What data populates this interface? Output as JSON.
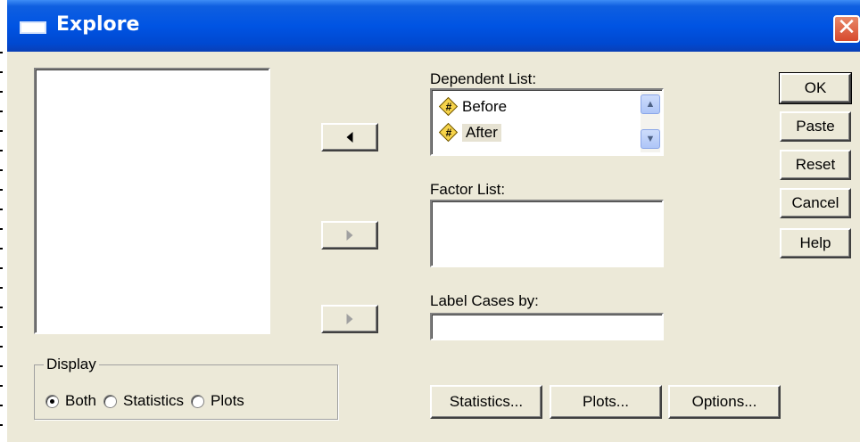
{
  "window": {
    "title": "Explore",
    "close_glyph": "✕"
  },
  "dependent_list": {
    "label": "Dependent List:",
    "items": [
      {
        "icon": "numeric-variable-icon",
        "label": "Before"
      },
      {
        "icon": "numeric-variable-icon",
        "label": "After"
      }
    ],
    "scroll_up": "▲",
    "scroll_down": "▼"
  },
  "factor_list": {
    "label": "Factor List:"
  },
  "label_cases": {
    "label": "Label Cases by:",
    "value": ""
  },
  "variable_icon_glyph": "#",
  "buttons": {
    "ok": "OK",
    "paste": "Paste",
    "reset": "Reset",
    "cancel": "Cancel",
    "help": "Help",
    "statistics": "Statistics...",
    "plots": "Plots...",
    "options": "Options..."
  },
  "display": {
    "title": "Display",
    "options": [
      "Both",
      "Statistics",
      "Plots"
    ],
    "selected": "Both"
  },
  "colors": {
    "titlebar": "#0054e3",
    "dialog_bg": "#ece9d8",
    "close_button": "#d7492c"
  }
}
